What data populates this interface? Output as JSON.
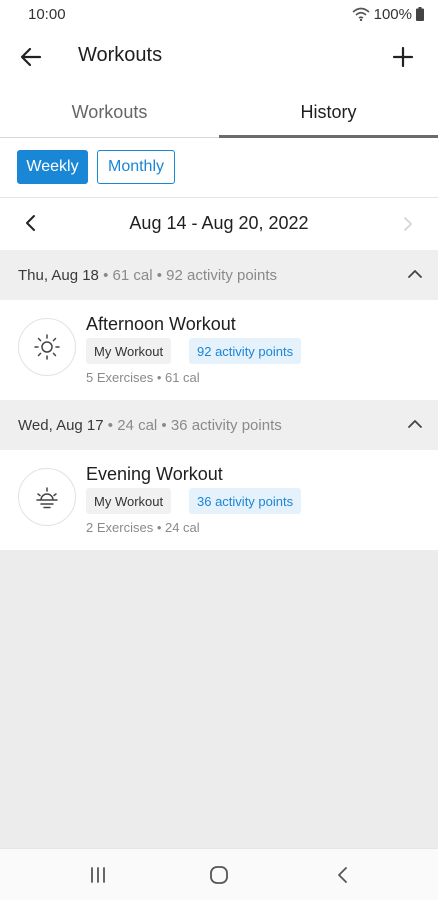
{
  "status_bar": {
    "time": "10:00",
    "battery": "100%"
  },
  "app_bar": {
    "title": "Workouts",
    "back_icon": "arrow-left-icon",
    "add_icon": "plus-icon"
  },
  "tabs": [
    {
      "label": "Workouts",
      "selected": false
    },
    {
      "label": "History",
      "selected": true
    }
  ],
  "filters": {
    "weekly_label": "Weekly",
    "monthly_label": "Monthly",
    "selected": "Weekly",
    "accent": "#1a86d6"
  },
  "date_nav": {
    "range": "Aug 14 - Aug 20, 2022"
  },
  "days": [
    {
      "day": "Thu, Aug 18",
      "cal": "61 cal",
      "points": "92 activity points",
      "workouts": [
        {
          "name": "Afternoon Workout",
          "tag": "My Workout",
          "points": "92 activity points",
          "exercises": "5 Exercises",
          "cal": "61 cal",
          "icon": "sun-icon"
        }
      ]
    },
    {
      "day": "Wed, Aug 17",
      "cal": "24 cal",
      "points": "36 activity points",
      "workouts": [
        {
          "name": "Evening Workout",
          "tag": "My Workout",
          "points": "36 activity points",
          "exercises": "2 Exercises",
          "cal": "24 cal",
          "icon": "sunset-icon"
        }
      ]
    }
  ],
  "separator": " • "
}
